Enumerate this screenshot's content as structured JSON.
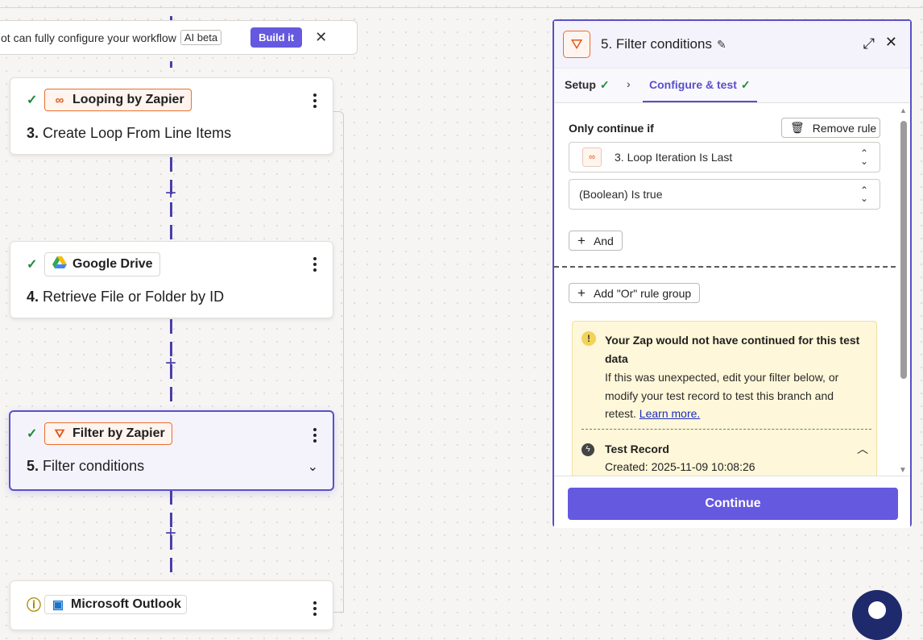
{
  "banner": {
    "text": "ot can fully configure your workflow",
    "badge": "AI beta",
    "build_label": "Build it",
    "close_glyph": "✕"
  },
  "steps": [
    {
      "status": "done",
      "app": "Looping by Zapier",
      "app_icon": "loop-icon",
      "number": "3.",
      "title": "Create Loop From Line Items"
    },
    {
      "status": "done",
      "app": "Google Drive",
      "app_icon": "google-drive-icon",
      "number": "4.",
      "title": "Retrieve File or Folder by ID"
    },
    {
      "status": "done",
      "app": "Filter by Zapier",
      "app_icon": "filter-icon",
      "number": "5.",
      "title": "Filter conditions",
      "active": true
    },
    {
      "status": "warning",
      "app": "Microsoft Outlook",
      "app_icon": "outlook-icon",
      "number": "",
      "title": ""
    }
  ],
  "panel": {
    "title": "5. Filter conditions",
    "tabs": [
      {
        "label": "Setup",
        "complete": true
      },
      {
        "label": "Configure & test",
        "complete": true,
        "active": true
      }
    ],
    "only_continue_label": "Only continue if",
    "remove_rule_label": "Remove rule",
    "field_select": "3. Loop Iteration Is Last",
    "condition_select": "(Boolean) Is true",
    "and_label": "And",
    "or_group_label": "Add \"Or\" rule group",
    "alert": {
      "title": "Your Zap would not have continued for this test data",
      "body": "If this was unexpected, edit your filter below, or modify your test record to test this branch and retest.",
      "link": "Learn more.",
      "record_title": "Test Record",
      "record_created": "Created: 2025-11-09 10:08:26"
    },
    "continue_label": "Continue"
  },
  "colors": {
    "accent": "#6559e0",
    "active_border": "#5a4fc8",
    "success": "#1f8a3a",
    "orange": "#e86f2d",
    "alert_bg": "#fef7d9"
  }
}
